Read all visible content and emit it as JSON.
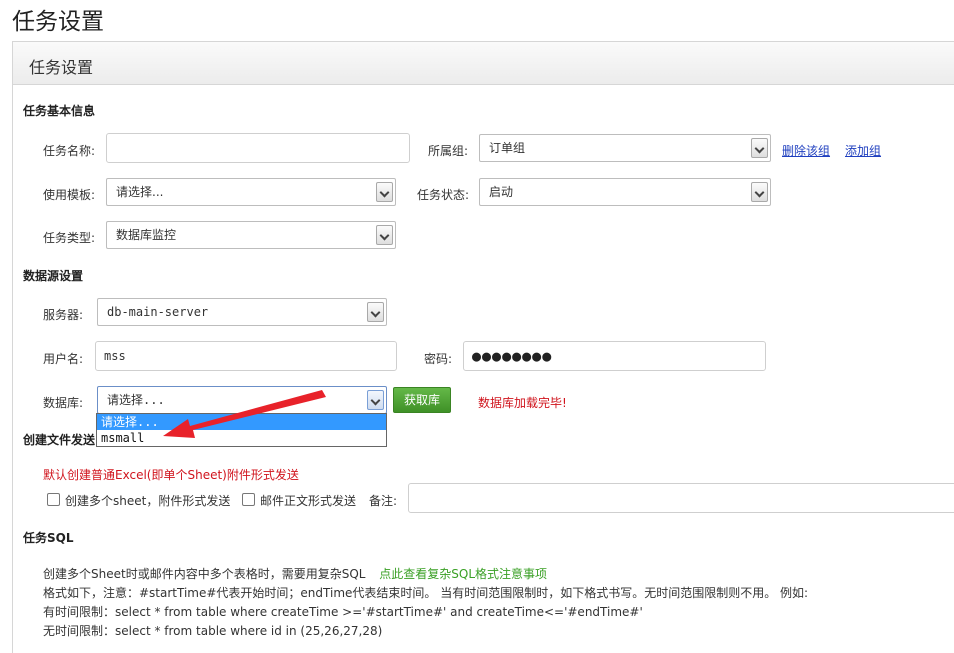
{
  "page": {
    "title": "任务设置"
  },
  "panel": {
    "title": "任务设置"
  },
  "basic": {
    "section_title": "任务基本信息",
    "task_name_label": "任务名称:",
    "task_name_value": "",
    "group_label": "所属组:",
    "group_value": "订单组",
    "delete_group": "删除该组",
    "add_group": "添加组",
    "template_label": "使用模板:",
    "template_value": "请选择...",
    "status_label": "任务状态:",
    "status_value": "启动",
    "type_label": "任务类型:",
    "type_value": "数据库监控"
  },
  "datasource": {
    "section_title": "数据源设置",
    "server_label": "服务器:",
    "server_value": "db-main-server",
    "username_label": "用户名:",
    "username_value": "mss",
    "password_label": "密码:",
    "password_value": "●●●●●●●●",
    "database_label": "数据库:",
    "database_value": "请选择...",
    "fetch_button": "获取库",
    "load_status": "数据库加载完毕!",
    "dropdown_options": [
      "请选择...",
      "msmall"
    ]
  },
  "file": {
    "section_title": "创建文件发送",
    "default_note": "默认创建普通Excel(即单个Sheet)附件形式发送",
    "multi_sheet_label": "创建多个sheet，附件形式发送",
    "body_label": "邮件正文形式发送",
    "remark_label": "备注:",
    "remark_value": ""
  },
  "sql": {
    "section_title": "任务SQL",
    "line1": "创建多个Sheet时或邮件内容中多个表格时，需要用复杂SQL",
    "line1_link": "点此查看复杂SQL格式注意事项",
    "line2": "格式如下，注意：#startTime#代表开始时间；endTime代表结束时间。 当有时间范围限制时，如下格式书写。无时间范围限制则不用。 例如:",
    "line3": "有时间限制：select * from table where createTime >='#startTime#' and createTime<='#endTime#'",
    "line4": "无时间限制：select * from table where id in (25,26,27,28)"
  },
  "colors": {
    "accent_red": "#d0141d",
    "link_green": "#3aa025",
    "button_green": "#4fa536",
    "selection_blue": "#3399ff"
  }
}
